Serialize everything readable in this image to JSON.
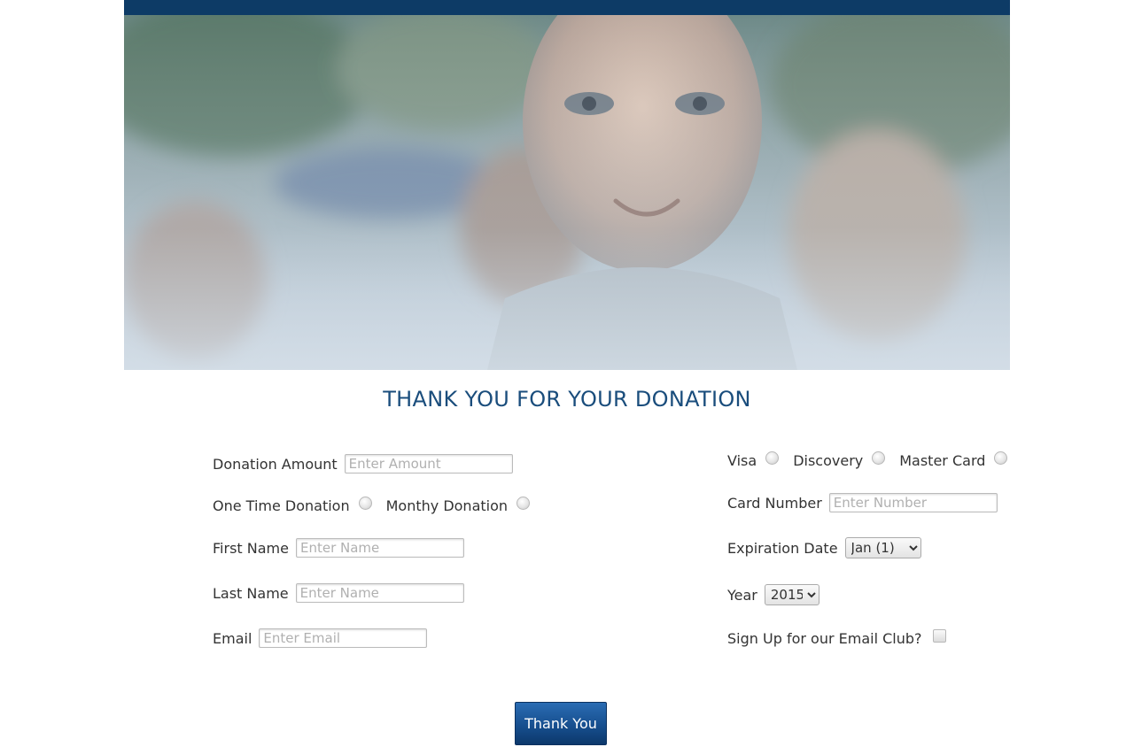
{
  "hero": {
    "image": "smiling-child-photo"
  },
  "title": "THANK YOU FOR YOUR DONATION",
  "left_form": {
    "donation_amount": {
      "label": "Donation Amount",
      "placeholder": "Enter Amount"
    },
    "frequency": {
      "one_time_label": "One Time Donation",
      "monthly_label": "Monthy Donation"
    },
    "first_name": {
      "label": "First Name",
      "placeholder": "Enter Name"
    },
    "last_name": {
      "label": "Last Name",
      "placeholder": "Enter Name"
    },
    "email": {
      "label": "Email",
      "placeholder": "Enter Email"
    }
  },
  "right_form": {
    "card_types": {
      "visa_label": "Visa",
      "discovery_label": "Discovery",
      "mastercard_label": "Master Card"
    },
    "card_number": {
      "label": "Card Number",
      "placeholder": "Enter Number"
    },
    "expiration": {
      "label": "Expiration Date",
      "selected": "Jan (1)"
    },
    "year": {
      "label": "Year",
      "selected": "2015"
    },
    "email_club": {
      "label": "Sign Up for our Email Club?"
    }
  },
  "submit_label": "Thank You",
  "colors": {
    "header_bar": "#0d3b66",
    "title": "#1a4d7c",
    "button": "#174f8f"
  }
}
